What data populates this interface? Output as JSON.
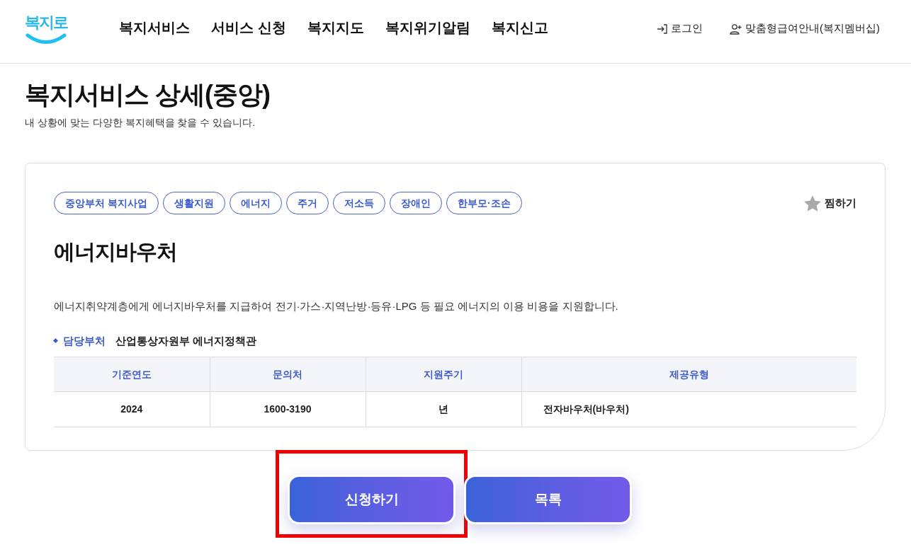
{
  "header": {
    "logo_text": "복지로",
    "nav": [
      "복지서비스",
      "서비스 신청",
      "복지지도",
      "복지위기알림",
      "복지신고"
    ],
    "login": "로그인",
    "membership": "맞춤형급여안내(복지멤버십)"
  },
  "page": {
    "title": "복지서비스 상세(중앙)",
    "subtitle": "내 상황에 맞는 다양한 복지혜택을 찾을 수 있습니다."
  },
  "service": {
    "tags": [
      "중앙부처 복지사업",
      "생활지원",
      "에너지",
      "주거",
      "저소득",
      "장애인",
      "한부모·조손"
    ],
    "favorite": {
      "label": "찜하기",
      "selected": false
    },
    "name": "에너지바우처",
    "description": "에너지취약계층에게 에너지바우처를 지급하여 전기·가스·지역난방·등유·LPG 등 필요 에너지의 이용 비용을 지원합니다.",
    "department": {
      "label": "담당부처",
      "value": "산업통상자원부 에너지정책관"
    },
    "table": {
      "columns": [
        "기준연도",
        "문의처",
        "지원주기",
        "제공유형"
      ],
      "rows": [
        [
          "2024",
          "1600-3190",
          "년",
          "전자바우처(바우처)"
        ]
      ]
    }
  },
  "buttons": [
    {
      "label": "신청하기",
      "highlighted": true
    },
    {
      "label": "목록",
      "highlighted": false
    }
  ]
}
